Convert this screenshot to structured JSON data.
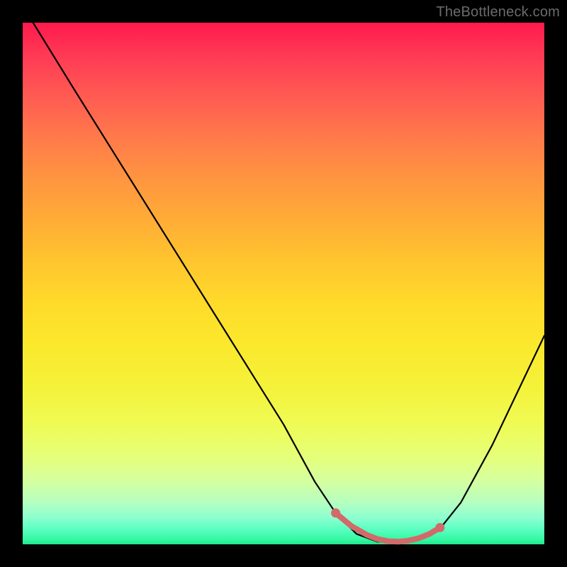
{
  "watermark": "TheBottleneck.com",
  "chart_data": {
    "type": "line",
    "title": "",
    "xlabel": "",
    "ylabel": "",
    "xlim": [
      0,
      100
    ],
    "ylim": [
      0,
      100
    ],
    "grid": false,
    "series": [
      {
        "name": "curve",
        "x": [
          2,
          10,
          20,
          30,
          40,
          50,
          56,
          60,
          64,
          68,
          72,
          76,
          80,
          84,
          90,
          100
        ],
        "values": [
          100,
          87,
          71,
          55,
          39,
          23,
          12,
          6,
          2,
          0.5,
          0.5,
          1,
          3,
          8,
          19,
          40
        ],
        "color": "#000000"
      },
      {
        "name": "highlight",
        "x": [
          60,
          63,
          66,
          68,
          70,
          72,
          74,
          76,
          78,
          80
        ],
        "values": [
          6,
          3.5,
          1.8,
          1,
          0.6,
          0.5,
          0.7,
          1.2,
          2,
          3.2
        ],
        "color": "#d26a6a"
      }
    ],
    "background_gradient": {
      "top": "#ff1a4d",
      "mid": "#ffe22e",
      "bottom": "#1fe989"
    }
  }
}
